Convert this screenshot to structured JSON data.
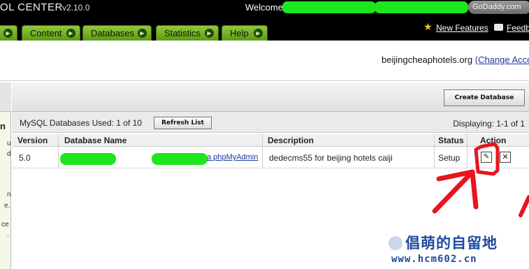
{
  "topbar": {
    "title": "OL CENTER",
    "version": "v2.10.0",
    "welcome": "Welcome",
    "godaddy_link": "GoDaddy.com"
  },
  "nav": {
    "tabs": [
      "Content",
      "Databases",
      "Statistics",
      "Help"
    ],
    "new_features": "New Features",
    "feedback": "Feedba"
  },
  "account": {
    "domain": "beijingcheaphotels.org",
    "change_account": "(Change Accou"
  },
  "toolbar": {
    "create_database": "Create Database",
    "refresh_list": "Refresh List"
  },
  "summary": {
    "used": "MySQL Databases Used: 1 of 10",
    "displaying": "Displaying: 1-1 of 1"
  },
  "table": {
    "headers": [
      "Version",
      "Database Name",
      "Description",
      "Status",
      "Action"
    ],
    "rows": [
      {
        "version": "5.0",
        "name_link": "a phpMyAdmin",
        "description": "dedecms55 for beijing hotels caiji",
        "status": "Setup"
      }
    ]
  },
  "sidebar": {
    "bold_letter": "n",
    "fragments": [
      "u",
      "d",
      "n",
      "e.",
      "ce",
      "."
    ]
  },
  "watermark": {
    "line1": "倡萌的自留地",
    "line2": "www.hcm602.cn"
  },
  "colors": {
    "nav_green": "#7ab32e",
    "redaction": "#1ee61e",
    "annotation_red": "#e8141e",
    "link_blue": "#1a3b9a"
  }
}
